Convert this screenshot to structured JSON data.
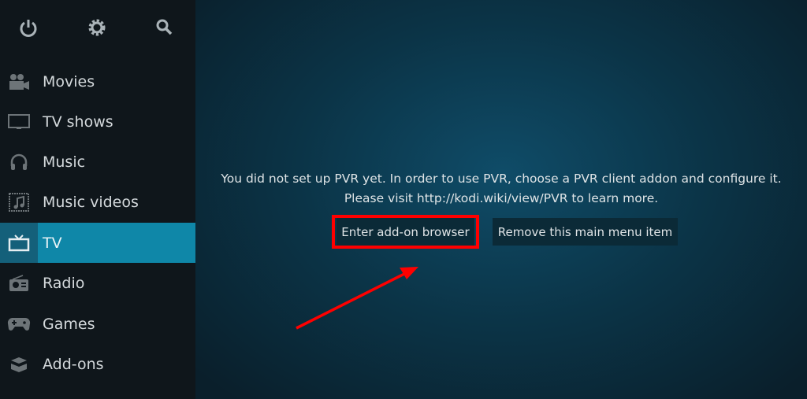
{
  "top_icons": [
    "power-icon",
    "gear-icon",
    "search-icon"
  ],
  "menu": [
    {
      "label": "Movies",
      "icon": "movie-camera-icon"
    },
    {
      "label": "TV shows",
      "icon": "monitor-icon"
    },
    {
      "label": "Music",
      "icon": "headphones-icon"
    },
    {
      "label": "Music videos",
      "icon": "music-video-icon"
    },
    {
      "label": "TV",
      "icon": "tv-icon",
      "active": true
    },
    {
      "label": "Radio",
      "icon": "radio-icon"
    },
    {
      "label": "Games",
      "icon": "gamepad-icon"
    },
    {
      "label": "Add-ons",
      "icon": "box-icon"
    }
  ],
  "main": {
    "message_line1": "You did not set up PVR yet. In order to use PVR, choose a PVR client addon and configure it.",
    "message_line2": "Please visit http://kodi.wiki/view/PVR to learn more.",
    "enter_button": "Enter add-on browser",
    "remove_button": "Remove this main menu item"
  },
  "colors": {
    "accent": "#0f87a8",
    "annotation": "#ff0000"
  }
}
